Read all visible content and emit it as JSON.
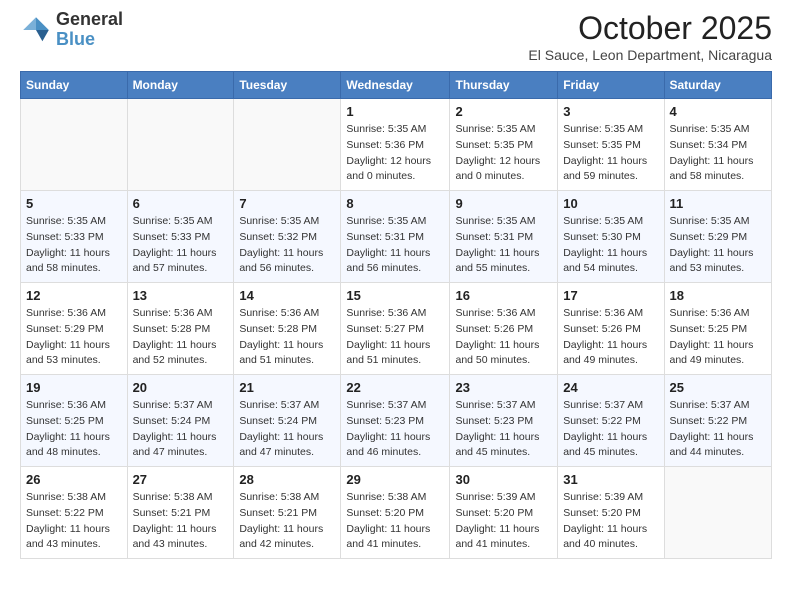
{
  "header": {
    "logo_general": "General",
    "logo_blue": "Blue",
    "main_title": "October 2025",
    "subtitle": "El Sauce, Leon Department, Nicaragua"
  },
  "days_of_week": [
    "Sunday",
    "Monday",
    "Tuesday",
    "Wednesday",
    "Thursday",
    "Friday",
    "Saturday"
  ],
  "weeks": [
    [
      {
        "day": "",
        "detail": ""
      },
      {
        "day": "",
        "detail": ""
      },
      {
        "day": "",
        "detail": ""
      },
      {
        "day": "1",
        "detail": "Sunrise: 5:35 AM\nSunset: 5:36 PM\nDaylight: 12 hours\nand 0 minutes."
      },
      {
        "day": "2",
        "detail": "Sunrise: 5:35 AM\nSunset: 5:35 PM\nDaylight: 12 hours\nand 0 minutes."
      },
      {
        "day": "3",
        "detail": "Sunrise: 5:35 AM\nSunset: 5:35 PM\nDaylight: 11 hours\nand 59 minutes."
      },
      {
        "day": "4",
        "detail": "Sunrise: 5:35 AM\nSunset: 5:34 PM\nDaylight: 11 hours\nand 58 minutes."
      }
    ],
    [
      {
        "day": "5",
        "detail": "Sunrise: 5:35 AM\nSunset: 5:33 PM\nDaylight: 11 hours\nand 58 minutes."
      },
      {
        "day": "6",
        "detail": "Sunrise: 5:35 AM\nSunset: 5:33 PM\nDaylight: 11 hours\nand 57 minutes."
      },
      {
        "day": "7",
        "detail": "Sunrise: 5:35 AM\nSunset: 5:32 PM\nDaylight: 11 hours\nand 56 minutes."
      },
      {
        "day": "8",
        "detail": "Sunrise: 5:35 AM\nSunset: 5:31 PM\nDaylight: 11 hours\nand 56 minutes."
      },
      {
        "day": "9",
        "detail": "Sunrise: 5:35 AM\nSunset: 5:31 PM\nDaylight: 11 hours\nand 55 minutes."
      },
      {
        "day": "10",
        "detail": "Sunrise: 5:35 AM\nSunset: 5:30 PM\nDaylight: 11 hours\nand 54 minutes."
      },
      {
        "day": "11",
        "detail": "Sunrise: 5:35 AM\nSunset: 5:29 PM\nDaylight: 11 hours\nand 53 minutes."
      }
    ],
    [
      {
        "day": "12",
        "detail": "Sunrise: 5:36 AM\nSunset: 5:29 PM\nDaylight: 11 hours\nand 53 minutes."
      },
      {
        "day": "13",
        "detail": "Sunrise: 5:36 AM\nSunset: 5:28 PM\nDaylight: 11 hours\nand 52 minutes."
      },
      {
        "day": "14",
        "detail": "Sunrise: 5:36 AM\nSunset: 5:28 PM\nDaylight: 11 hours\nand 51 minutes."
      },
      {
        "day": "15",
        "detail": "Sunrise: 5:36 AM\nSunset: 5:27 PM\nDaylight: 11 hours\nand 51 minutes."
      },
      {
        "day": "16",
        "detail": "Sunrise: 5:36 AM\nSunset: 5:26 PM\nDaylight: 11 hours\nand 50 minutes."
      },
      {
        "day": "17",
        "detail": "Sunrise: 5:36 AM\nSunset: 5:26 PM\nDaylight: 11 hours\nand 49 minutes."
      },
      {
        "day": "18",
        "detail": "Sunrise: 5:36 AM\nSunset: 5:25 PM\nDaylight: 11 hours\nand 49 minutes."
      }
    ],
    [
      {
        "day": "19",
        "detail": "Sunrise: 5:36 AM\nSunset: 5:25 PM\nDaylight: 11 hours\nand 48 minutes."
      },
      {
        "day": "20",
        "detail": "Sunrise: 5:37 AM\nSunset: 5:24 PM\nDaylight: 11 hours\nand 47 minutes."
      },
      {
        "day": "21",
        "detail": "Sunrise: 5:37 AM\nSunset: 5:24 PM\nDaylight: 11 hours\nand 47 minutes."
      },
      {
        "day": "22",
        "detail": "Sunrise: 5:37 AM\nSunset: 5:23 PM\nDaylight: 11 hours\nand 46 minutes."
      },
      {
        "day": "23",
        "detail": "Sunrise: 5:37 AM\nSunset: 5:23 PM\nDaylight: 11 hours\nand 45 minutes."
      },
      {
        "day": "24",
        "detail": "Sunrise: 5:37 AM\nSunset: 5:22 PM\nDaylight: 11 hours\nand 45 minutes."
      },
      {
        "day": "25",
        "detail": "Sunrise: 5:37 AM\nSunset: 5:22 PM\nDaylight: 11 hours\nand 44 minutes."
      }
    ],
    [
      {
        "day": "26",
        "detail": "Sunrise: 5:38 AM\nSunset: 5:22 PM\nDaylight: 11 hours\nand 43 minutes."
      },
      {
        "day": "27",
        "detail": "Sunrise: 5:38 AM\nSunset: 5:21 PM\nDaylight: 11 hours\nand 43 minutes."
      },
      {
        "day": "28",
        "detail": "Sunrise: 5:38 AM\nSunset: 5:21 PM\nDaylight: 11 hours\nand 42 minutes."
      },
      {
        "day": "29",
        "detail": "Sunrise: 5:38 AM\nSunset: 5:20 PM\nDaylight: 11 hours\nand 41 minutes."
      },
      {
        "day": "30",
        "detail": "Sunrise: 5:39 AM\nSunset: 5:20 PM\nDaylight: 11 hours\nand 41 minutes."
      },
      {
        "day": "31",
        "detail": "Sunrise: 5:39 AM\nSunset: 5:20 PM\nDaylight: 11 hours\nand 40 minutes."
      },
      {
        "day": "",
        "detail": ""
      }
    ]
  ]
}
